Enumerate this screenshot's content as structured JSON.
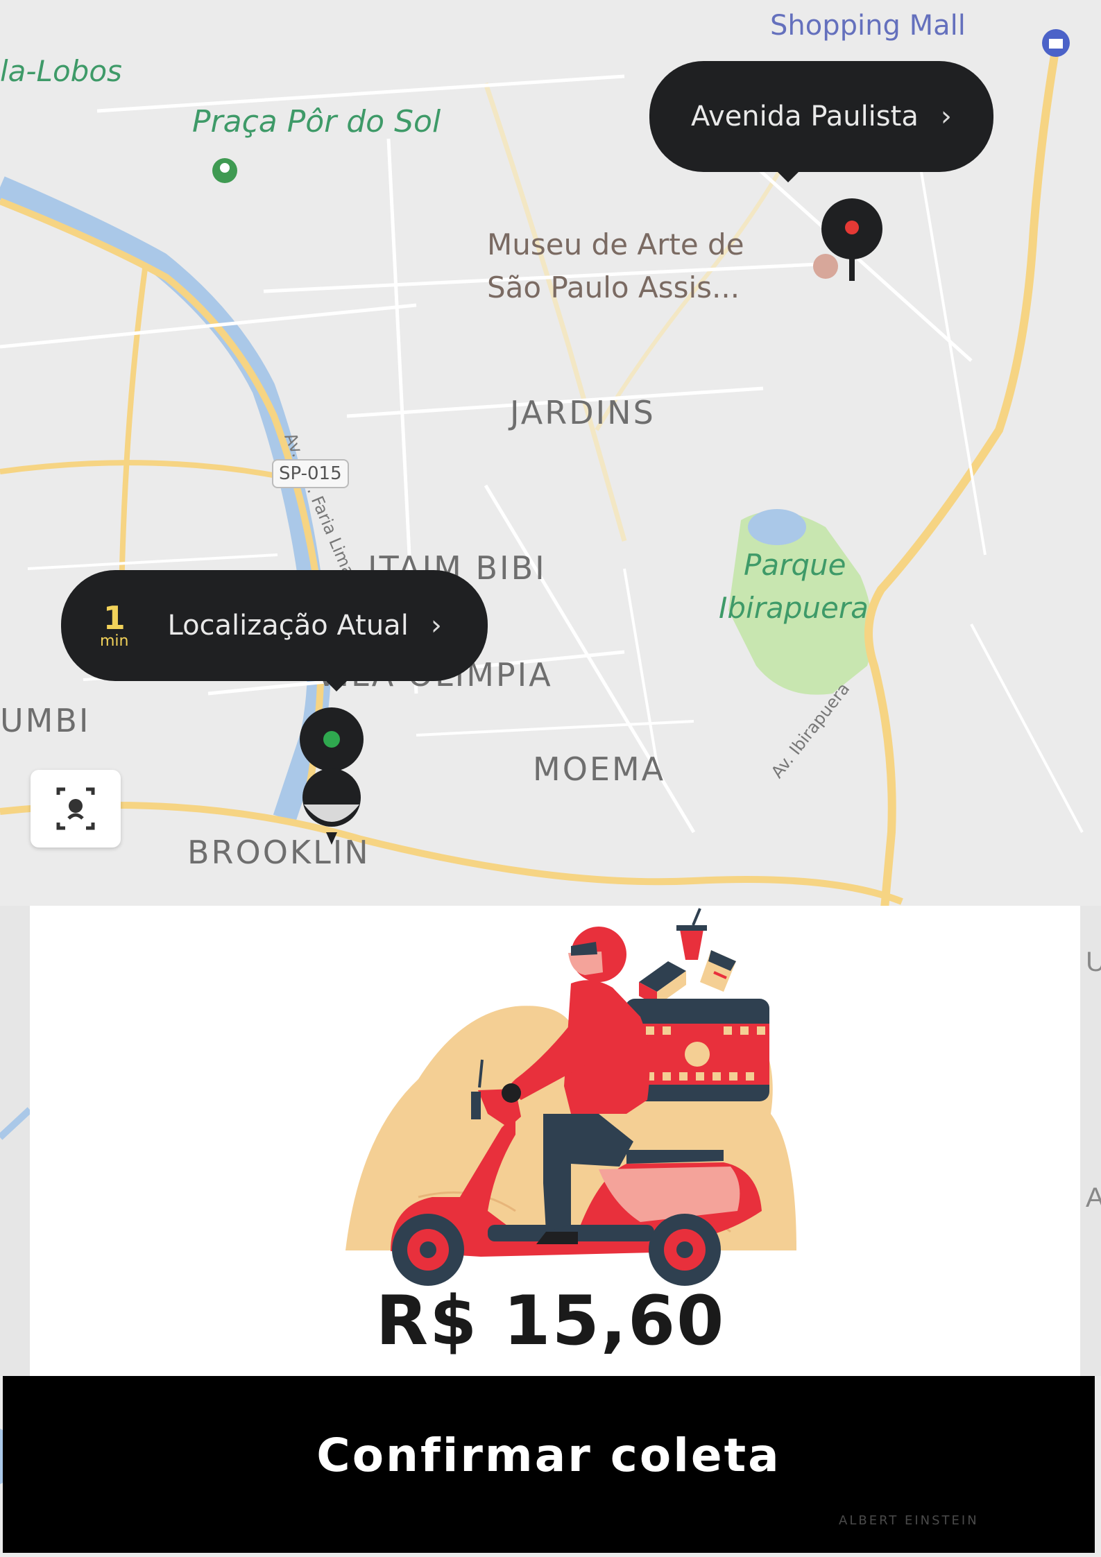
{
  "colors": {
    "map_background": "#ebebeb",
    "callout": "#1f2022",
    "park": "#c8e6b0",
    "water": "#aac8e8",
    "road_major": "#f6d483",
    "accent_red": "#e8303c",
    "button": "#000000"
  },
  "map": {
    "labels": {
      "shopping": "Shopping Mall",
      "lobos": "la-Lobos",
      "praca": "Praça Pôr do Sol",
      "museu_line1": "Museu de Arte de",
      "museu_line2": "São Paulo Assis...",
      "faria_lima": "Av. Brg. Faria Lima",
      "jardins": "JARDINS",
      "sp015": "SP-015",
      "itaim": "ITAIM BIBI",
      "parque_line1": "Parque",
      "parque_line2": "Ibirapuera",
      "ibirapuera_av": "Av. Ibirapuera",
      "mumbi": "UMBI",
      "moema": "MOEMA",
      "brooklin": "BROOKLIN",
      "vila": "VILA OLIMPIA"
    },
    "destination_callout": {
      "label": "Avenida Paulista",
      "icon": "chevron-right-icon"
    },
    "current_callout": {
      "eta_value": "1",
      "eta_unit": "min",
      "label": "Localização Atual",
      "icon": "chevron-right-icon"
    },
    "recenter_icon": "locate-icon"
  },
  "card": {
    "illustration": "delivery-scooter-rider",
    "price": "R$ 15,60"
  },
  "confirm_button": {
    "label": "Confirmar coleta"
  },
  "watermark": "ALBERT EINSTEIN"
}
